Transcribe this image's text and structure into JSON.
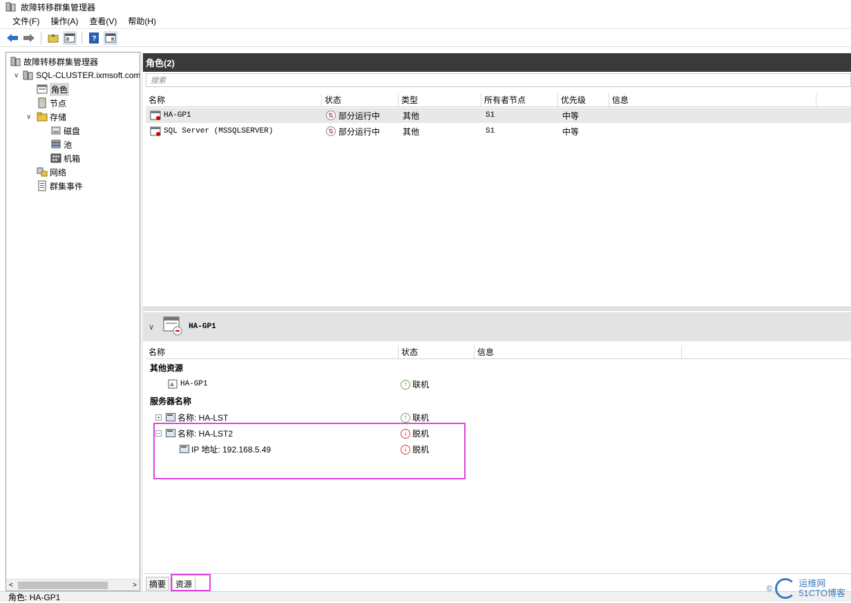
{
  "window": {
    "title": "故障转移群集管理器"
  },
  "menu": [
    "文件(F)",
    "操作(A)",
    "查看(V)",
    "帮助(H)"
  ],
  "tree": {
    "root": "故障转移群集管理器",
    "cluster": "SQL-CLUSTER.ixmsoft.com",
    "roles": "角色",
    "nodes": "节点",
    "storage": "存储",
    "disks": "磁盘",
    "pools": "池",
    "enclosures": "机箱",
    "networks": "网络",
    "events": "群集事件"
  },
  "roles_panel": {
    "header": "角色(2)",
    "search_placeholder": "搜索",
    "columns": [
      "名称",
      "状态",
      "类型",
      "所有者节点",
      "优先级",
      "信息"
    ],
    "rows": [
      {
        "name": "HA-GP1",
        "status": "部分运行中",
        "type": "其他",
        "owner": "S1",
        "priority": "中等",
        "info": ""
      },
      {
        "name": "SQL Server (MSSQLSERVER)",
        "status": "部分运行中",
        "type": "其他",
        "owner": "S1",
        "priority": "中等",
        "info": ""
      }
    ]
  },
  "detail": {
    "title": "HA-GP1",
    "columns": [
      "名称",
      "状态",
      "信息"
    ],
    "section_other": "其他资源",
    "section_server": "服务器名称",
    "other_resource": {
      "name": "HA-GP1",
      "status": "联机"
    },
    "server_items": [
      {
        "name": "名称: HA-LST",
        "status": "联机",
        "expanded": false
      },
      {
        "name": "名称: HA-LST2",
        "status": "脱机",
        "expanded": true
      }
    ],
    "ip_item": {
      "name": "IP 地址: 192.168.5.49",
      "status": "脱机"
    }
  },
  "tabs": [
    "摘要",
    "资源"
  ],
  "statusbar": "角色: HA-GP1",
  "watermark": {
    "line1": "运维网",
    "line2": "51CTO博客",
    "prefix": "©"
  },
  "colors": {
    "highlight": "#e040e0",
    "header_dark": "#3a3a3a",
    "online": "#2e8b2e",
    "offline": "#cc0000"
  }
}
